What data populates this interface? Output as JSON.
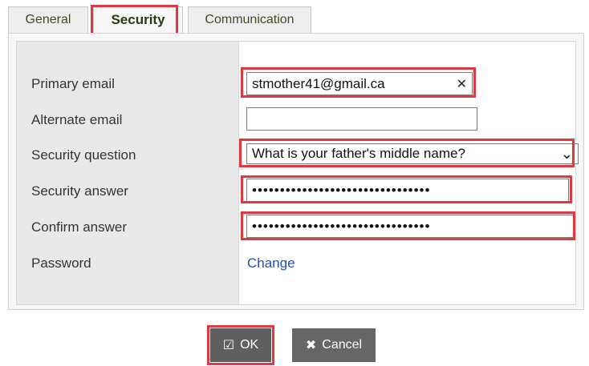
{
  "tabs": {
    "general": "General",
    "security": "Security",
    "communication": "Communication"
  },
  "form": {
    "primary_email": {
      "label": "Primary email",
      "value": "stmother41@gmail.ca"
    },
    "alternate_email": {
      "label": "Alternate email",
      "value": ""
    },
    "security_question": {
      "label": "Security question",
      "value": "What is your father's middle name?"
    },
    "security_answer": {
      "label": "Security answer",
      "value": "••••••••••••••••••••••••••••••••"
    },
    "confirm_answer": {
      "label": "Confirm answer",
      "value": "••••••••••••••••••••••••••••••••"
    },
    "password": {
      "label": "Password",
      "link": "Change"
    }
  },
  "buttons": {
    "ok": "OK",
    "cancel": "Cancel"
  },
  "icons": {
    "clear": "close-icon",
    "dropdown": "chevron-down-icon",
    "ok": "checkbox-icon",
    "cancel": "x-icon"
  },
  "colors": {
    "highlight": "#e0383e",
    "link": "#1f4fb5",
    "button": "#5f5f5f"
  }
}
